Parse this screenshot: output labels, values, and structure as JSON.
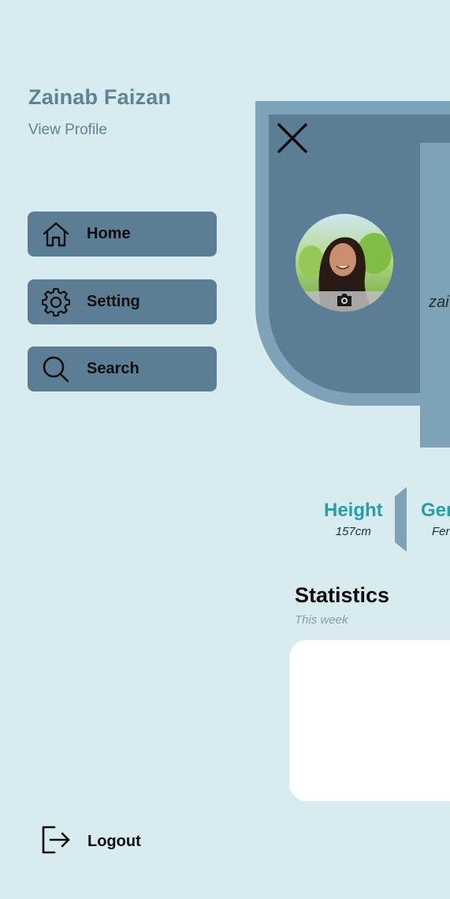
{
  "drawer": {
    "user_name": "Zainab Faizan",
    "view_profile": "View Profile",
    "menu": [
      {
        "label": "Home",
        "icon": "home-icon"
      },
      {
        "label": "Setting",
        "icon": "gear-icon"
      },
      {
        "label": "Search",
        "icon": "search-icon"
      }
    ],
    "logout": {
      "label": "Logout",
      "icon": "logout-icon"
    }
  },
  "main": {
    "close_icon": "close-icon",
    "avatar_camera_icon": "camera-icon",
    "card_name_partial": "zai",
    "stats": [
      {
        "title": "Height",
        "value": "157cm"
      },
      {
        "title": "Gen",
        "value": "Fen"
      }
    ],
    "statistics": {
      "title": "Statistics",
      "subtitle": "This week"
    }
  },
  "colors": {
    "background": "#d8ecf0",
    "menu_item": "#5b7e94",
    "accent_text": "#23a0a8",
    "name_text": "#5d8397",
    "card_light": "#7ea3b6"
  }
}
